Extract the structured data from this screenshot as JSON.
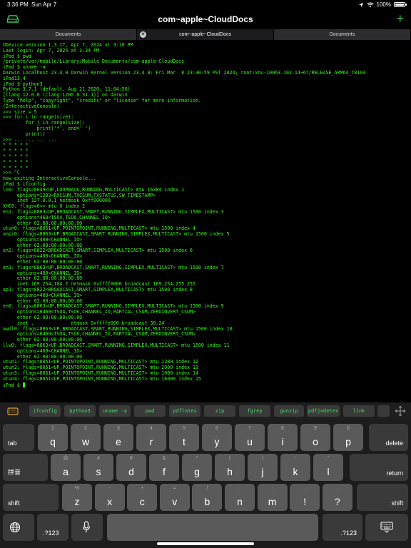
{
  "status": {
    "time": "3:36 PM",
    "date": "Sun Apr 7",
    "battery": "100%",
    "battery_level": 1.0
  },
  "title": "com~apple~CloudDocs",
  "tabs": [
    {
      "label": "Documents"
    },
    {
      "label": "com~apple~CloudDocs"
    },
    {
      "label": "Documents"
    }
  ],
  "terminal_lines": [
    "UDevice version 1.3.17, Apr 7, 2024 at 3:10 PM",
    "Last login: Apr 7, 2024 at 3:34 PM",
    "iPad $ pwd",
    "/private/var/mobile/Library/Mobile Documents/com~apple~CloudDocs",
    "iPad $ uname -a",
    "Darwin Localhost 23.4.0 Darwin Kernel Version 23.4.0: Fri Mar  8 23:30:59 PST 2024; root:xnu-10063.102.14~67/RELEASE_ARM64_T8103",
    "iPad13,4",
    "iPad $ python3",
    "Python 3.7.1 (default, Aug 21 2020, 11:04:50)",
    "[Clang 12.0.0 (clang-1200.0.31.1)] on darwin",
    "Type \"help\", \"copyright\", \"credits\" or \"license\" for more information.",
    "(InteractiveConsole)",
    ">>> size = 5",
    ">>> for i in range(size):",
    "        for j in range(size):",
    "            print('*', end=' ')",
    "        print()",
    ">>> ... ... ... ...",
    "* * * * *",
    "* * * * *",
    "* * * * *",
    "* * * * *",
    "* * * * *",
    ">>> ^C",
    "",
    "now exiting InteractiveConsole...",
    "iPad $ ifconfig",
    "lo0: flags=8049<UP,LOOPBACK,RUNNING,MULTICAST> mtu 16384 index 1",
    "     options=1203<RXCSUM,TXCSUM,TXSTATUS,SW_TIMESTAMP>",
    "     inet 127.0.0.1 netmask 0xff000000",
    "XHC0: flags=0<> mtu 0 index 2",
    "en1: flags=8863<UP,BROADCAST,SMART,RUNNING,SIMPLEX,MULTICAST> mtu 1500 index 3",
    "     options=460<TSO4,TSO6,CHANNEL_IO>",
    "     ether 02:00:00:00:00:00",
    "utun0: flags=8051<UP,POINTOPOINT,RUNNING,MULTICAST> mtu 1500 index 4",
    "anpi0: flags=8863<UP,BROADCAST,SMART,RUNNING,SIMPLEX,MULTICAST> mtu 1500 index 5",
    "     options=400<CHANNEL_IO>",
    "     ether 02:00:00:00:00:00",
    "en2: flags=8822<BROADCAST,SMART,SIMPLEX,MULTICAST> mtu 1500 index 6",
    "     options=400<CHANNEL_IO>",
    "     ether 02:00:00:00:00:00",
    "en3: flags=8863<UP,BROADCAST,SMART,RUNNING,SIMPLEX,MULTICAST> mtu 1500 index 7",
    "     options=400<CHANNEL_IO>",
    "     ether 02:00:00:00:00:00",
    "     inet 169.254.104.7 netmask 0xffff0000 broadcast 169.254.255.255",
    "ap1: flags=8822<BROADCAST,SMART,SIMPLEX,MULTICAST> mtu 1500 index 8",
    "     options=400<CHANNEL_IO>",
    "     ether 02:00:00:00:00:00",
    "en0: flags=8863<UP,BROADCAST,SMART,RUNNING,SIMPLEX,MULTICAST> mtu 1500 index 9",
    "     options=6460<TSO4,TSO6,CHANNEL_IO,PARTIAL_CSUM,ZEROINVERT_CSUM>",
    "     ether 02:00:00:00:00:00",
    "     inet .             etmask 0xffffe000 broadcast 30.24",
    "awdl0: flags=8863<UP,BROADCAST,SMART,RUNNING,SIMPLEX,MULTICAST> mtu 1500 index 10",
    "     options=6460<TSO4,TSO6,CHANNEL_IO,PARTIAL_CSUM,ZEROINVERT_CSUM>",
    "     ether 02:00:00:00:00:00",
    "llw0: flags=8863<UP,BROADCAST,SMART,RUNNING,SIMPLEX,MULTICAST> mtu 1500 index 11",
    "     options=400<CHANNEL_IO>",
    "     ether 02:00:00:00:00:00",
    "utun1: flags=8051<UP,POINTOPOINT,RUNNING,MULTICAST> mtu 1380 index 12",
    "utun2: flags=8051<UP,POINTOPOINT,RUNNING,MULTICAST> mtu 2000 index 13",
    "utun3: flags=8051<UP,POINTOPOINT,RUNNING,MULTICAST> mtu 1000 index 14",
    "utun4: flags=8051<UP,POINTOPOINT,RUNNING,MULTICAST> mtu 16000 index 15",
    "iPad $ "
  ],
  "shortcuts": [
    "ifconfig",
    "python3",
    "uname -a",
    "pwd",
    "pdflatex",
    "zip",
    "fgrep",
    "gunzip",
    "pdfjadetex",
    "link"
  ],
  "keyboard": {
    "row1": [
      {
        "main": "q",
        "sub": "1"
      },
      {
        "main": "w",
        "sub": "2"
      },
      {
        "main": "e",
        "sub": "3"
      },
      {
        "main": "r",
        "sub": "4"
      },
      {
        "main": "t",
        "sub": "5"
      },
      {
        "main": "y",
        "sub": "6"
      },
      {
        "main": "u",
        "sub": "7"
      },
      {
        "main": "i",
        "sub": "8"
      },
      {
        "main": "o",
        "sub": "9"
      },
      {
        "main": "p",
        "sub": "0"
      }
    ],
    "row2": [
      {
        "main": "a",
        "sub": "@"
      },
      {
        "main": "s",
        "sub": "#"
      },
      {
        "main": "d",
        "sub": "¥"
      },
      {
        "main": "f",
        "sub": "&"
      },
      {
        "main": "g",
        "sub": "*"
      },
      {
        "main": "h",
        "sub": "("
      },
      {
        "main": "j",
        "sub": ")"
      },
      {
        "main": "k",
        "sub": "'"
      },
      {
        "main": "l",
        "sub": "\""
      }
    ],
    "row3": [
      {
        "main": "z",
        "sub": "%"
      },
      {
        "main": "x",
        "sub": "-"
      },
      {
        "main": "c",
        "sub": "+"
      },
      {
        "main": "v",
        "sub": "="
      },
      {
        "main": "b",
        "sub": "/"
      },
      {
        "main": "n",
        "sub": ";"
      },
      {
        "main": "m",
        "sub": ":"
      },
      {
        "main": "!",
        "sub": ","
      },
      {
        "main": "?",
        "sub": "."
      }
    ],
    "tab": "tab",
    "delete": "delete",
    "ime": "拼音",
    "return": "return",
    "shift_left": "shift",
    "shift_right": "shift",
    "num_left": ".?123",
    "num_right": ".?123"
  },
  "colors": {
    "terminal_text": "#39ff14",
    "accent": "#34c759"
  }
}
